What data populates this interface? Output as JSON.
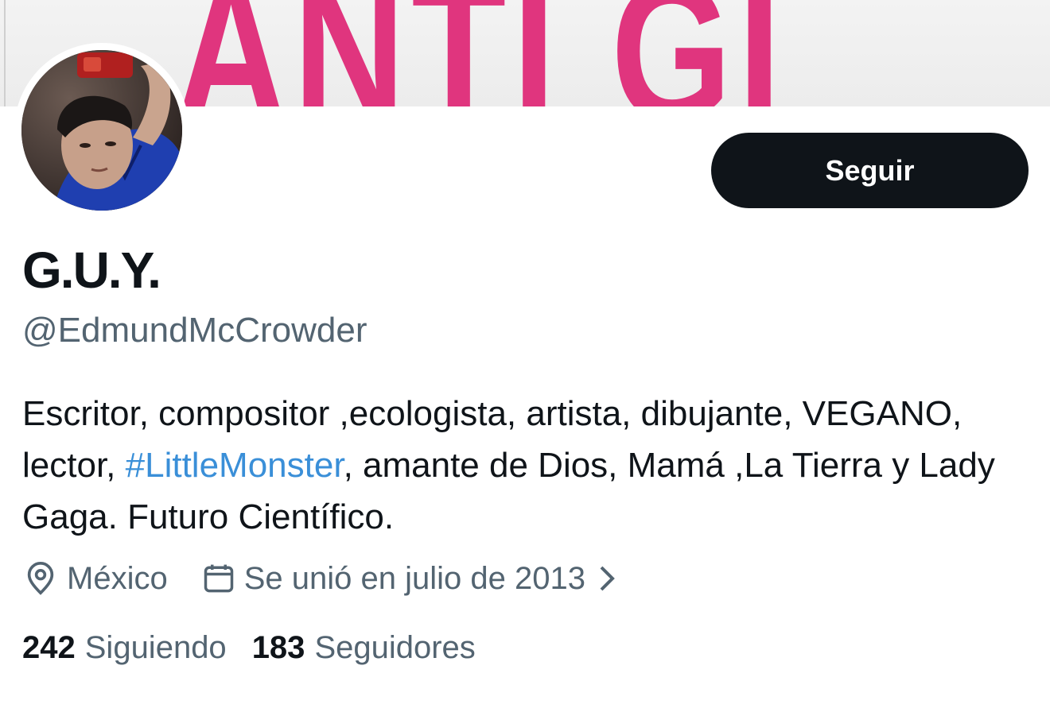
{
  "banner": {
    "art_text": "ANTI GI"
  },
  "profile": {
    "display_name": "G.U.Y.",
    "handle": "@EdmundMcCrowder",
    "bio": {
      "part1": "Escritor, compositor ,ecologista, artista, dibujante, VEGANO, lector, ",
      "hashtag": "#LittleMonster",
      "part2": ", amante de Dios, Mamá ,La Tierra y Lady Gaga. Futuro Científico."
    },
    "location": "México",
    "joined": "Se unió en julio de 2013",
    "following_count": "242",
    "following_label": "Siguiendo",
    "followers_count": "183",
    "followers_label": "Seguidores"
  },
  "actions": {
    "follow_label": "Seguir"
  },
  "icons": {
    "location": "location-pin-icon",
    "calendar": "calendar-icon",
    "chevron": "chevron-right-icon"
  },
  "colors": {
    "text_primary": "#0f1419",
    "text_secondary": "#536471",
    "hashtag": "#3a8fd8",
    "banner_accent": "#e0357e",
    "button_bg": "#0f1419"
  }
}
